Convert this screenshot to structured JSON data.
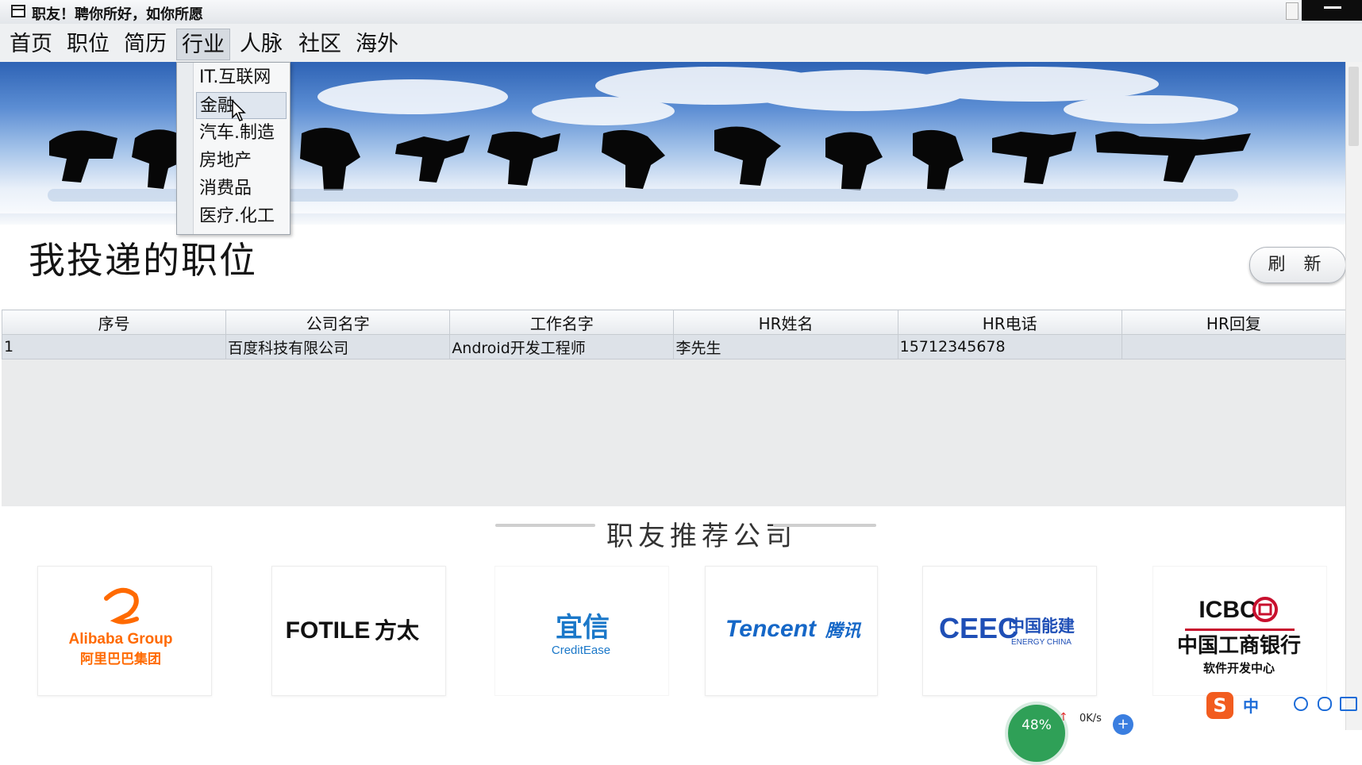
{
  "window": {
    "title": "职友！聘你所好，如你所愿"
  },
  "menubar": {
    "items": [
      {
        "label": "首页"
      },
      {
        "label": "职位"
      },
      {
        "label": "简历"
      },
      {
        "label": "行业"
      },
      {
        "label": "人脉"
      },
      {
        "label": "社区"
      },
      {
        "label": "海外"
      }
    ],
    "active_index": 3
  },
  "dropdown": {
    "items": [
      {
        "label": "IT.互联网"
      },
      {
        "label": "金融"
      },
      {
        "label": "汽车.制造"
      },
      {
        "label": "房地产"
      },
      {
        "label": "消费品"
      },
      {
        "label": "医疗.化工"
      }
    ],
    "hover_index": 1
  },
  "main": {
    "title": "我投递的职位",
    "refresh_label": "刷 新"
  },
  "table": {
    "columns": [
      "序号",
      "公司名字",
      "工作名字",
      "HR姓名",
      "HR电话",
      "HR回复"
    ],
    "rows": [
      [
        "1",
        "百度科技有限公司",
        "Android开发工程师",
        "李先生",
        "15712345678",
        ""
      ]
    ]
  },
  "recommend": {
    "title": "职友推荐公司",
    "companies": [
      {
        "name": "Alibaba Group",
        "name_cn": "阿里巴巴集团",
        "brand_color": "#ff6a00"
      },
      {
        "name": "FOTILE",
        "name_cn": "方太",
        "brand_color": "#111111"
      },
      {
        "name": "CreditEase",
        "name_cn": "宜信",
        "brand_color": "#1b78c9"
      },
      {
        "name": "Tencent",
        "name_cn": "腾讯",
        "brand_color": "#1567c7"
      },
      {
        "name": "ENERGY CHINA",
        "name_cn": "中国能建",
        "brand_color": "#1f4fb6"
      },
      {
        "name": "ICBC",
        "name_cn": "中国工商银行",
        "sub": "软件开发中心",
        "brand_color": "#c8102e"
      }
    ]
  },
  "tray": {
    "cpu_percent": "48%",
    "net_speed": "0K/s",
    "ime_label": "中"
  }
}
